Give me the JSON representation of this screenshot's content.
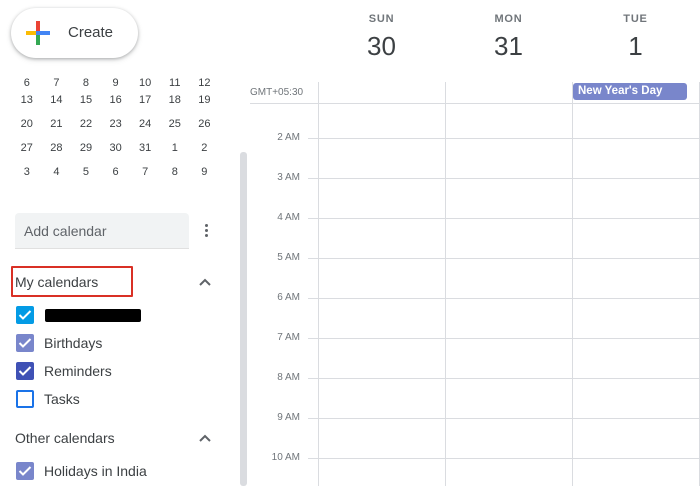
{
  "create": {
    "label": "Create",
    "icon": "plus-icon"
  },
  "mini_calendar": {
    "partial_row": [
      "6",
      "7",
      "8",
      "9",
      "10",
      "11",
      "12"
    ],
    "weeks": [
      [
        "13",
        "14",
        "15",
        "16",
        "17",
        "18",
        "19"
      ],
      [
        "20",
        "21",
        "22",
        "23",
        "24",
        "25",
        "26"
      ],
      [
        "27",
        "28",
        "29",
        "30",
        "31",
        "1",
        "2"
      ],
      [
        "3",
        "4",
        "5",
        "6",
        "7",
        "8",
        "9"
      ]
    ]
  },
  "add_calendar": {
    "placeholder": "Add calendar",
    "menu_icon": "more-vert-icon"
  },
  "my_calendars": {
    "title": "My calendars",
    "items": [
      {
        "label": "",
        "color": "#039be5",
        "checked": true
      },
      {
        "label": "Birthdays",
        "color": "#7986cb",
        "checked": true
      },
      {
        "label": "Reminders",
        "color": "#3f51b5",
        "checked": true
      },
      {
        "label": "Tasks",
        "color": "#1a73e8",
        "checked": false
      }
    ]
  },
  "other_calendars": {
    "title": "Other calendars",
    "items": [
      {
        "label": "Holidays in India",
        "color": "#7986cb",
        "checked": true
      }
    ]
  },
  "days": [
    {
      "dow": "SUN",
      "num": "30"
    },
    {
      "dow": "MON",
      "num": "31"
    },
    {
      "dow": "TUE",
      "num": "1"
    }
  ],
  "timezone": "GMT+05:30",
  "hours": [
    "2 AM",
    "3 AM",
    "4 AM",
    "5 AM",
    "6 AM",
    "7 AM",
    "8 AM",
    "9 AM",
    "10 AM"
  ],
  "all_day_event": {
    "title": "New Year's Day",
    "color": "#7986cb",
    "day": "TUE"
  }
}
